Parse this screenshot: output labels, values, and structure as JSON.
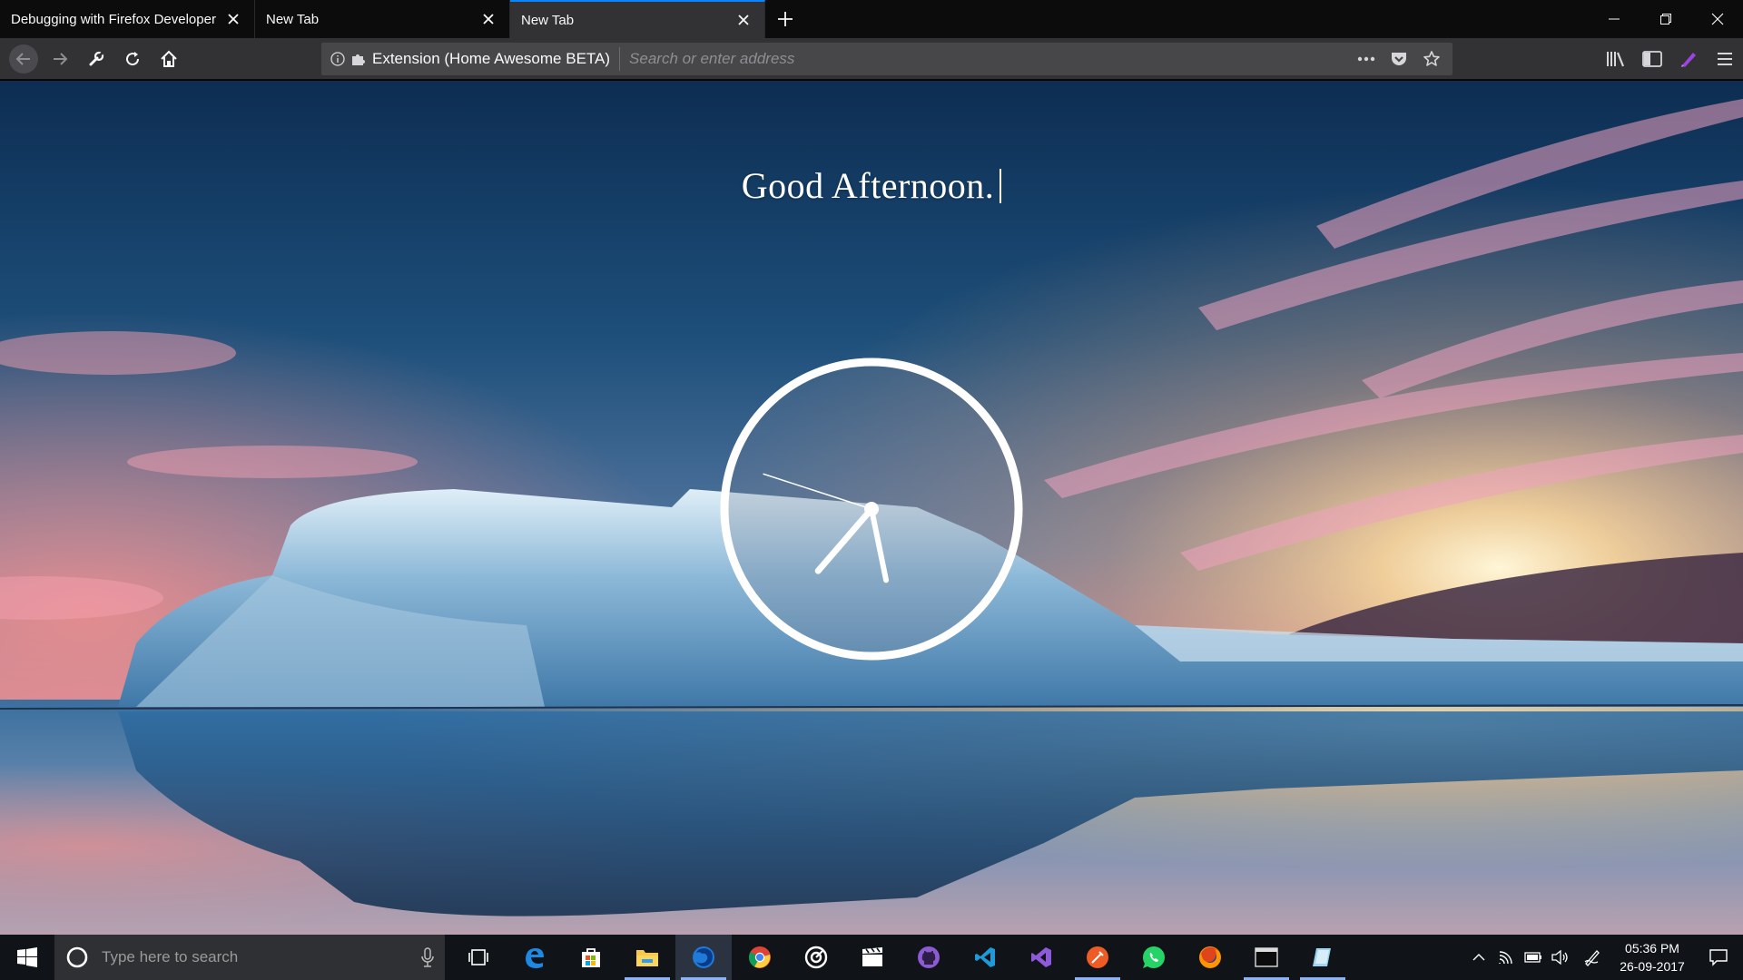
{
  "browser": {
    "tabs": [
      {
        "title": "Debugging with Firefox Developer",
        "selected": false
      },
      {
        "title": "New Tab",
        "selected": false
      },
      {
        "title": "New Tab",
        "selected": true
      }
    ],
    "urlbar": {
      "identity_label": "Extension (Home Awesome BETA)",
      "placeholder": "Search or enter address",
      "value": ""
    }
  },
  "page": {
    "greeting": "Good Afternoon.",
    "clock": {
      "hour": 5,
      "minute": 36,
      "second": 48
    }
  },
  "taskbar": {
    "search_placeholder": "Type here to search",
    "apps": [
      {
        "name": "task-view"
      },
      {
        "name": "edge"
      },
      {
        "name": "store"
      },
      {
        "name": "file-explorer"
      },
      {
        "name": "firefox-developer-edition",
        "active": true
      },
      {
        "name": "chrome"
      },
      {
        "name": "groove-music"
      },
      {
        "name": "movies-tv"
      },
      {
        "name": "github-desktop"
      },
      {
        "name": "vs-code"
      },
      {
        "name": "visual-studio"
      },
      {
        "name": "postman"
      },
      {
        "name": "whatsapp"
      },
      {
        "name": "firefox"
      },
      {
        "name": "terminal"
      },
      {
        "name": "notes"
      }
    ],
    "time": "05:36 PM",
    "date": "26-09-2017"
  },
  "colors": {
    "accent": "#0a84ff",
    "chrome_dark": "#0c0c0d",
    "toolbar": "#323234",
    "urlbar": "#474749"
  }
}
